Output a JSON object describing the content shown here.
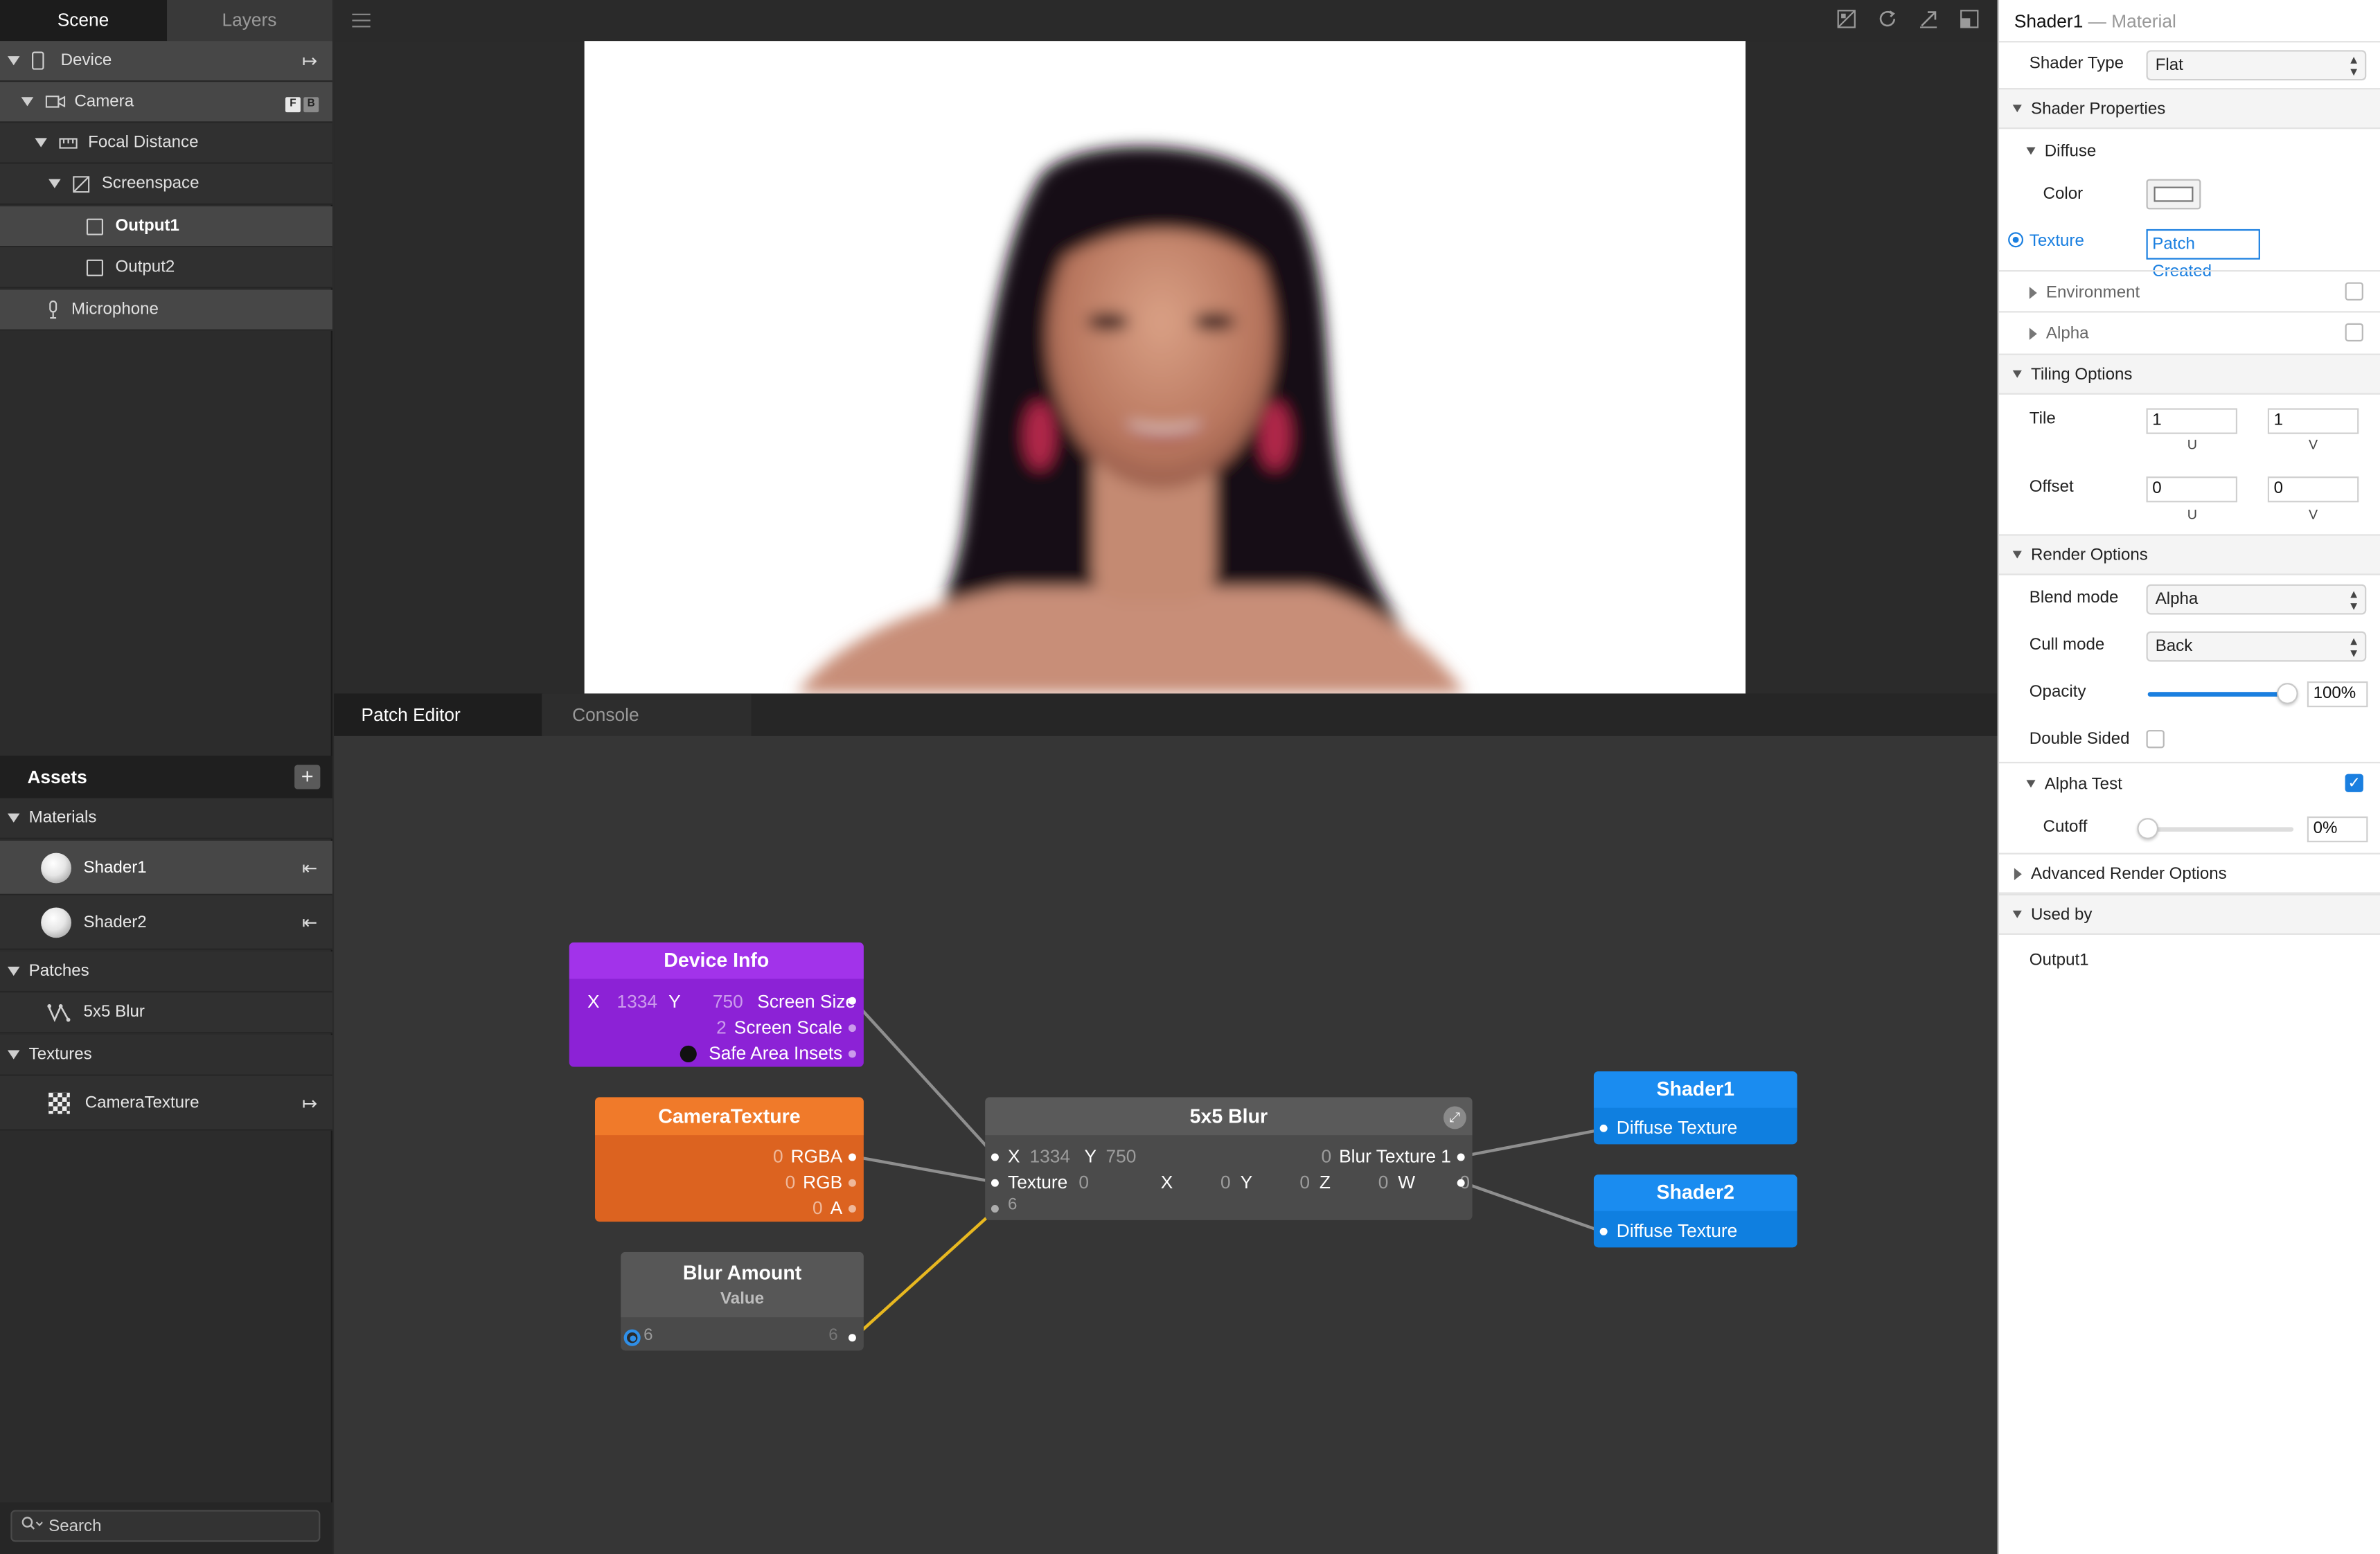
{
  "scene_panel": {
    "tabs": [
      "Scene",
      "Layers"
    ],
    "tree": [
      {
        "label": "Device",
        "icon": "phone-icon"
      },
      {
        "label": "Camera",
        "icon": "camera-icon",
        "badges": [
          "F",
          "B"
        ]
      },
      {
        "label": "Focal Distance",
        "icon": "ruler-icon"
      },
      {
        "label": "Screenspace",
        "icon": "screenspace-icon"
      },
      {
        "label": "Output1",
        "icon": "rectangle-icon"
      },
      {
        "label": "Output2",
        "icon": "rectangle-icon"
      },
      {
        "label": "Microphone",
        "icon": "microphone-icon"
      }
    ]
  },
  "assets": {
    "title": "Assets",
    "add_label": "+",
    "materials": {
      "label": "Materials",
      "items": [
        "Shader1",
        "Shader2"
      ]
    },
    "patches": {
      "label": "Patches",
      "items": [
        "5x5 Blur"
      ]
    },
    "textures": {
      "label": "Textures",
      "items": [
        "CameraTexture"
      ]
    },
    "search_placeholder": "Search"
  },
  "bottom_tabs": [
    "Patch Editor",
    "Console"
  ],
  "patch_editor": {
    "device_info": {
      "title": "Device Info",
      "screen_size": {
        "x_label": "X",
        "x": "1334",
        "y_label": "Y",
        "y": "750",
        "label": "Screen Size"
      },
      "screen_scale": {
        "value": "2",
        "label": "Screen Scale"
      },
      "safe_area": {
        "label": "Safe Area Insets"
      }
    },
    "camera_texture": {
      "title": "CameraTexture",
      "rgba": {
        "value": "0",
        "label": "RGBA"
      },
      "rgb": {
        "value": "0",
        "label": "RGB"
      },
      "a": {
        "value": "0",
        "label": "A"
      }
    },
    "blur_amount": {
      "title": "Blur Amount",
      "subtitle": "Value",
      "left_value": "6",
      "right_value": "6"
    },
    "blur": {
      "title": "5x5 Blur",
      "x_label": "X",
      "x": "1334",
      "y_label": "Y",
      "y": "750",
      "texture_label": "Texture",
      "texture_value": "0",
      "vx_label": "X",
      "vx": "0",
      "vy_label": "Y",
      "vy": "0",
      "vz_label": "Z",
      "vz": "0",
      "vw_label": "W",
      "vw": "0",
      "amount": "6",
      "output_value": "0",
      "output_label": "Blur Texture 1"
    },
    "shader1": {
      "title": "Shader1",
      "port": "Diffuse Texture"
    },
    "shader2": {
      "title": "Shader2",
      "port": "Diffuse Texture"
    }
  },
  "inspector": {
    "title": "Shader1",
    "separator": "—",
    "subtitle": "Material",
    "shader_type_label": "Shader Type",
    "shader_type_value": "Flat",
    "shader_properties": "Shader Properties",
    "diffuse": "Diffuse",
    "color_label": "Color",
    "texture_label": "Texture",
    "texture_value": "Patch Created",
    "environment": "Environment",
    "alpha": "Alpha",
    "tiling_options": "Tiling Options",
    "tile_label": "Tile",
    "tile_u": "1",
    "tile_v": "1",
    "offset_label": "Offset",
    "offset_u": "0",
    "offset_v": "0",
    "u_label": "U",
    "v_label": "V",
    "render_options": "Render Options",
    "blend_mode_label": "Blend mode",
    "blend_mode_value": "Alpha",
    "cull_mode_label": "Cull mode",
    "cull_mode_value": "Back",
    "opacity_label": "Opacity",
    "opacity_value": "100%",
    "opacity_level": 1.0,
    "double_sided_label": "Double Sided",
    "alpha_test_label": "Alpha Test",
    "alpha_test_checked": true,
    "cutoff_label": "Cutoff",
    "cutoff_value": "0%",
    "cutoff_level": 0.0,
    "advanced_render_options": "Advanced Render Options",
    "used_by": "Used by",
    "used_by_value": "Output1"
  },
  "colors": {
    "device_info": "#9b2fe0",
    "camera_texture": "#f07a2a",
    "shader_node": "#1a8cf0",
    "blur_node": "#555555",
    "accent": "#1a7fe0"
  }
}
